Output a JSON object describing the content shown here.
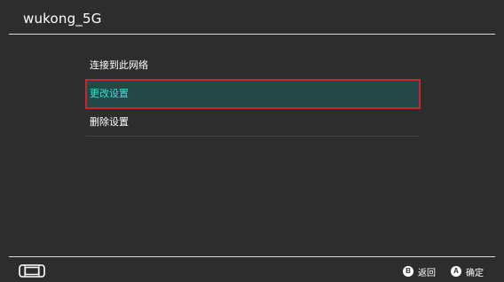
{
  "header": {
    "title": "wukong_5G"
  },
  "menu": {
    "items": [
      {
        "label": "连接到此网络",
        "selected": false
      },
      {
        "label": "更改设置",
        "selected": true
      },
      {
        "label": "删除设置",
        "selected": false
      }
    ]
  },
  "footer": {
    "controller_icon": "handheld-controller-icon",
    "hints": [
      {
        "button": "B",
        "label": "返回"
      },
      {
        "button": "A",
        "label": "确定"
      }
    ]
  },
  "colors": {
    "background": "#2d2d2d",
    "selected_background": "#244747",
    "selected_text": "#2ee8d8",
    "focus_border": "#d0212b"
  }
}
